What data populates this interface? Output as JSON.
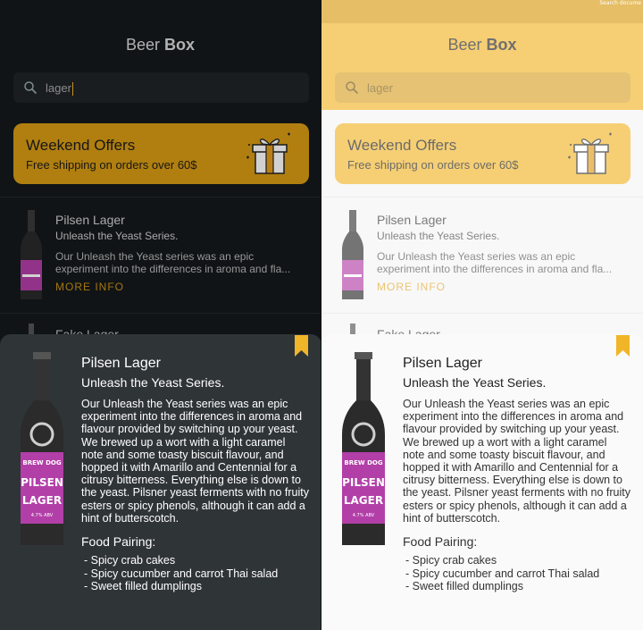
{
  "app_title": {
    "regular": "Beer",
    "bold": "Box"
  },
  "corner_text": "Search docume",
  "search": {
    "dark_value": "lager",
    "light_value": "lager"
  },
  "offer": {
    "title": "Weekend Offers",
    "subtitle": "Free shipping on orders over 60$"
  },
  "list": {
    "item": {
      "name": "Pilsen Lager",
      "tagline": "Unleash the Yeast Series.",
      "description": "Our Unleash the Yeast series was an epic experiment into the differences in aroma and fla...",
      "more_label": "MORE INFO"
    },
    "next_item_partial": "Fake Lager"
  },
  "detail": {
    "name": "Pilsen Lager",
    "tagline": "Unleash the Yeast Series.",
    "description": "Our Unleash the Yeast series was an epic experiment into the differences in aroma and flavour provided by switching up your yeast. We brewed up a wort with a light caramel note and some toasty biscuit flavour, and hopped it with Amarillo and Centennial for a citrusy bitterness. Everything else is down to the yeast. Pilsner yeast ferments with no fruity esters or spicy phenols, although it can add a hint of butterscotch.",
    "food_pairing_label": "Food Pairing:",
    "food_pairing": [
      "- Spicy crab cakes",
      "- Spicy cucumber and carrot Thai salad",
      "- Sweet filled dumplings"
    ]
  },
  "bottle_label": {
    "brand": "BREW DOG",
    "line1": "PILSEN",
    "line2": "LAGER",
    "abv": "4.7% ABV"
  },
  "colors": {
    "accent": "#f1b52a",
    "accent_dark": "#d79c14",
    "label_purple": "#b23fa8",
    "dark_bg": "#14191b",
    "dark_sheet": "#2f3437"
  }
}
